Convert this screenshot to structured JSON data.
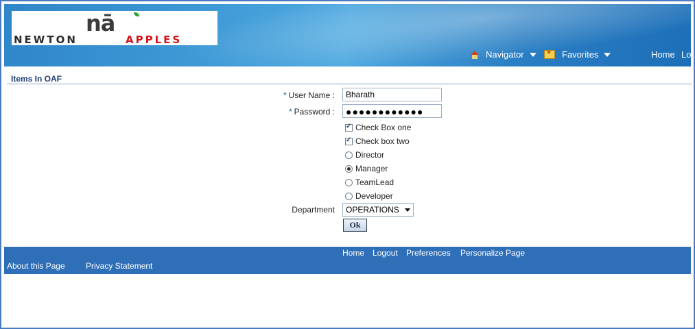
{
  "header": {
    "logo": {
      "na": "nā",
      "newton": "NEWTON",
      "apples": "APPLES"
    },
    "navigator_label": "Navigator",
    "favorites_label": "Favorites",
    "home_label": "Home",
    "logout_partial": "Lo"
  },
  "page_title": "Items In OAF",
  "form": {
    "user_name_label": "User Name :",
    "user_name_value": "Bharath",
    "password_label": "Password :",
    "password_value": "●●●●●●●●●●●●",
    "required_marker": "*",
    "checkboxes": [
      {
        "label": "Check Box one",
        "checked": true
      },
      {
        "label": "Check box two",
        "checked": true
      }
    ],
    "radios": [
      {
        "label": "Director",
        "checked": false
      },
      {
        "label": "Manager",
        "checked": true
      },
      {
        "label": "TeamLead",
        "checked": false
      },
      {
        "label": "Developer",
        "checked": false
      }
    ],
    "department_label": "Department",
    "department_value": "OPERATIONS",
    "ok_label": "Ok"
  },
  "footer": {
    "links": [
      "Home",
      "Logout",
      "Preferences",
      "Personalize Page"
    ],
    "about": "About this Page",
    "privacy": "Privacy Statement"
  },
  "colors": {
    "header_blue": "#2f86c8",
    "footer_blue": "#2f6fb8",
    "title_navy": "#1e3f73",
    "logo_red": "#d4141a"
  }
}
